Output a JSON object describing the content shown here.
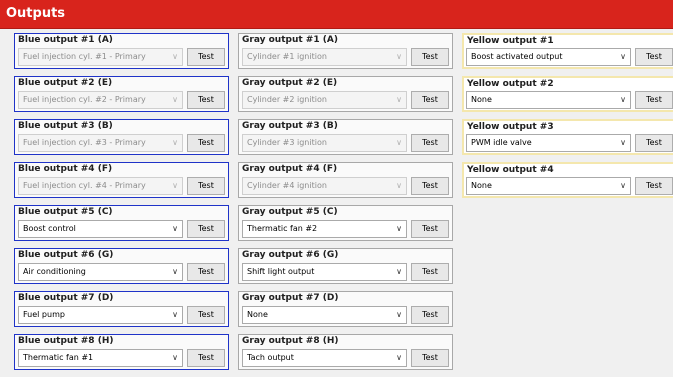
{
  "header": {
    "title": "Outputs"
  },
  "test_label": "Test",
  "blue": [
    {
      "label": "Blue output #1 (A)",
      "value": "Fuel injection cyl. #1 - Primary",
      "disabled": true
    },
    {
      "label": "Blue output #2 (E)",
      "value": "Fuel injection cyl. #2 - Primary",
      "disabled": true
    },
    {
      "label": "Blue output #3 (B)",
      "value": "Fuel injection cyl. #3 - Primary",
      "disabled": true
    },
    {
      "label": "Blue output #4 (F)",
      "value": "Fuel injection cyl. #4 - Primary",
      "disabled": true
    },
    {
      "label": "Blue output #5 (C)",
      "value": "Boost control",
      "disabled": false
    },
    {
      "label": "Blue output #6 (G)",
      "value": "Air conditioning",
      "disabled": false
    },
    {
      "label": "Blue output #7 (D)",
      "value": "Fuel pump",
      "disabled": false
    },
    {
      "label": "Blue output #8 (H)",
      "value": "Thermatic fan #1",
      "disabled": false
    }
  ],
  "gray": [
    {
      "label": "Gray output #1 (A)",
      "value": "Cylinder #1 ignition",
      "disabled": true
    },
    {
      "label": "Gray output #2 (E)",
      "value": "Cylinder #2 ignition",
      "disabled": true
    },
    {
      "label": "Gray output #3 (B)",
      "value": "Cylinder #3 ignition",
      "disabled": true
    },
    {
      "label": "Gray output #4 (F)",
      "value": "Cylinder #4 ignition",
      "disabled": true
    },
    {
      "label": "Gray output #5 (C)",
      "value": "Thermatic fan #2",
      "disabled": false
    },
    {
      "label": "Gray output #6 (G)",
      "value": "Shift light output",
      "disabled": false
    },
    {
      "label": "Gray output #7 (D)",
      "value": "None",
      "disabled": false
    },
    {
      "label": "Gray output #8 (H)",
      "value": "Tach output",
      "disabled": false
    }
  ],
  "yellow": [
    {
      "label": "Yellow output #1",
      "value": "Boost activated output",
      "disabled": false
    },
    {
      "label": "Yellow output #2",
      "value": "None",
      "disabled": false
    },
    {
      "label": "Yellow output #3",
      "value": "PWM idle valve",
      "disabled": false
    },
    {
      "label": "Yellow output #4",
      "value": "None",
      "disabled": false
    }
  ],
  "colors": {
    "titlebar": "#d8241c",
    "blue_border": "#1f33c8",
    "gray_border": "#a8a8a8",
    "yellow_border": "#f4e7ad"
  },
  "icons": {
    "dropdown": "chevron-down-icon"
  }
}
